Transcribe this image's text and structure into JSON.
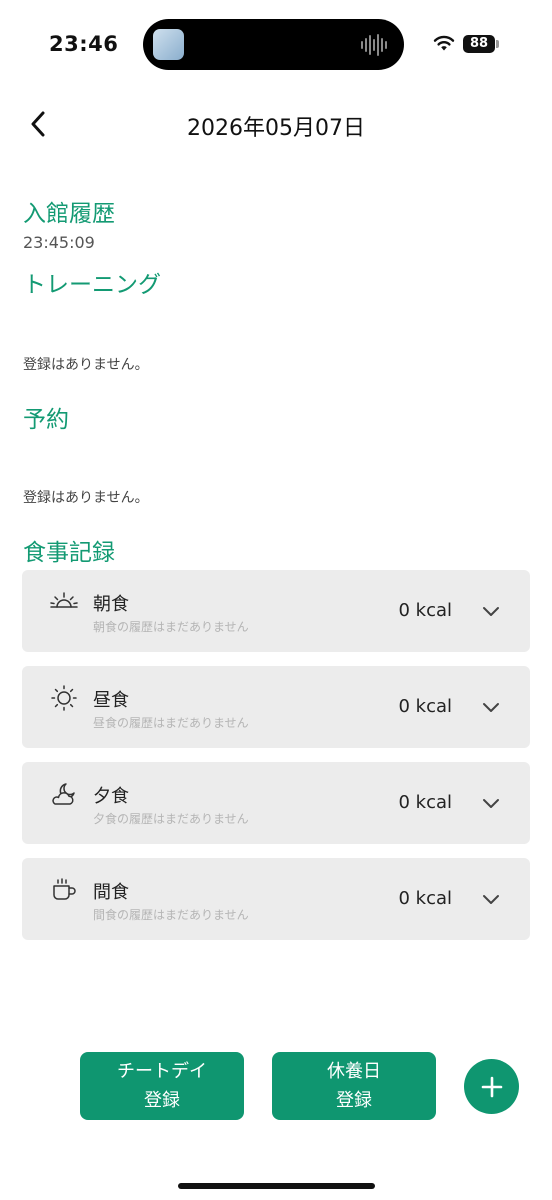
{
  "status_bar": {
    "time": "23:46",
    "battery": "88"
  },
  "header": {
    "title": "2026年05月07日"
  },
  "entry_history": {
    "title": "入館履歴",
    "time": "23:45:09"
  },
  "training": {
    "title": "トレーニング",
    "empty": "登録はありません。"
  },
  "reservation": {
    "title": "予約",
    "empty": "登録はありません。"
  },
  "meal_record": {
    "title": "食事記録",
    "meals": [
      {
        "name": "朝食",
        "sub": "朝食の履歴はまだありません",
        "kcal": "0 kcal",
        "icon": "sunrise-icon"
      },
      {
        "name": "昼食",
        "sub": "昼食の履歴はまだありません",
        "kcal": "0 kcal",
        "icon": "sun-icon"
      },
      {
        "name": "夕食",
        "sub": "夕食の履歴はまだありません",
        "kcal": "0 kcal",
        "icon": "moon-cloud-icon"
      },
      {
        "name": "間食",
        "sub": "間食の履歴はまだありません",
        "kcal": "0 kcal",
        "icon": "coffee-cup-icon"
      }
    ]
  },
  "buttons": {
    "cheat_day_line1": "チートデイ",
    "cheat_day_line2": "登録",
    "rest_day_line1": "休養日",
    "rest_day_line2": "登録"
  },
  "colors": {
    "accent": "#139a73",
    "button": "#0f9670",
    "card_bg": "#ececec"
  }
}
